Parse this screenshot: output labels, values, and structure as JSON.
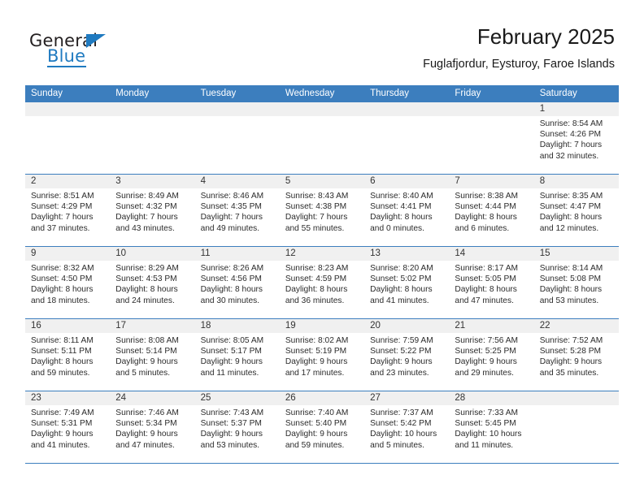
{
  "logo": {
    "primary_text": "General",
    "secondary_text": "Blue",
    "accent_color": "#1f7ac0",
    "triangle_icon": "triangle-icon"
  },
  "header": {
    "title": "February 2025",
    "subtitle": "Fuglafjordur, Eysturoy, Faroe Islands"
  },
  "calendar": {
    "header_bg": "#3c7ebe",
    "weekdays": [
      "Sunday",
      "Monday",
      "Tuesday",
      "Wednesday",
      "Thursday",
      "Friday",
      "Saturday"
    ],
    "weeks": [
      [
        {
          "day": "",
          "lines": []
        },
        {
          "day": "",
          "lines": []
        },
        {
          "day": "",
          "lines": []
        },
        {
          "day": "",
          "lines": []
        },
        {
          "day": "",
          "lines": []
        },
        {
          "day": "",
          "lines": []
        },
        {
          "day": "1",
          "lines": [
            "Sunrise: 8:54 AM",
            "Sunset: 4:26 PM",
            "Daylight: 7 hours",
            "and 32 minutes."
          ]
        }
      ],
      [
        {
          "day": "2",
          "lines": [
            "Sunrise: 8:51 AM",
            "Sunset: 4:29 PM",
            "Daylight: 7 hours",
            "and 37 minutes."
          ]
        },
        {
          "day": "3",
          "lines": [
            "Sunrise: 8:49 AM",
            "Sunset: 4:32 PM",
            "Daylight: 7 hours",
            "and 43 minutes."
          ]
        },
        {
          "day": "4",
          "lines": [
            "Sunrise: 8:46 AM",
            "Sunset: 4:35 PM",
            "Daylight: 7 hours",
            "and 49 minutes."
          ]
        },
        {
          "day": "5",
          "lines": [
            "Sunrise: 8:43 AM",
            "Sunset: 4:38 PM",
            "Daylight: 7 hours",
            "and 55 minutes."
          ]
        },
        {
          "day": "6",
          "lines": [
            "Sunrise: 8:40 AM",
            "Sunset: 4:41 PM",
            "Daylight: 8 hours",
            "and 0 minutes."
          ]
        },
        {
          "day": "7",
          "lines": [
            "Sunrise: 8:38 AM",
            "Sunset: 4:44 PM",
            "Daylight: 8 hours",
            "and 6 minutes."
          ]
        },
        {
          "day": "8",
          "lines": [
            "Sunrise: 8:35 AM",
            "Sunset: 4:47 PM",
            "Daylight: 8 hours",
            "and 12 minutes."
          ]
        }
      ],
      [
        {
          "day": "9",
          "lines": [
            "Sunrise: 8:32 AM",
            "Sunset: 4:50 PM",
            "Daylight: 8 hours",
            "and 18 minutes."
          ]
        },
        {
          "day": "10",
          "lines": [
            "Sunrise: 8:29 AM",
            "Sunset: 4:53 PM",
            "Daylight: 8 hours",
            "and 24 minutes."
          ]
        },
        {
          "day": "11",
          "lines": [
            "Sunrise: 8:26 AM",
            "Sunset: 4:56 PM",
            "Daylight: 8 hours",
            "and 30 minutes."
          ]
        },
        {
          "day": "12",
          "lines": [
            "Sunrise: 8:23 AM",
            "Sunset: 4:59 PM",
            "Daylight: 8 hours",
            "and 36 minutes."
          ]
        },
        {
          "day": "13",
          "lines": [
            "Sunrise: 8:20 AM",
            "Sunset: 5:02 PM",
            "Daylight: 8 hours",
            "and 41 minutes."
          ]
        },
        {
          "day": "14",
          "lines": [
            "Sunrise: 8:17 AM",
            "Sunset: 5:05 PM",
            "Daylight: 8 hours",
            "and 47 minutes."
          ]
        },
        {
          "day": "15",
          "lines": [
            "Sunrise: 8:14 AM",
            "Sunset: 5:08 PM",
            "Daylight: 8 hours",
            "and 53 minutes."
          ]
        }
      ],
      [
        {
          "day": "16",
          "lines": [
            "Sunrise: 8:11 AM",
            "Sunset: 5:11 PM",
            "Daylight: 8 hours",
            "and 59 minutes."
          ]
        },
        {
          "day": "17",
          "lines": [
            "Sunrise: 8:08 AM",
            "Sunset: 5:14 PM",
            "Daylight: 9 hours",
            "and 5 minutes."
          ]
        },
        {
          "day": "18",
          "lines": [
            "Sunrise: 8:05 AM",
            "Sunset: 5:17 PM",
            "Daylight: 9 hours",
            "and 11 minutes."
          ]
        },
        {
          "day": "19",
          "lines": [
            "Sunrise: 8:02 AM",
            "Sunset: 5:19 PM",
            "Daylight: 9 hours",
            "and 17 minutes."
          ]
        },
        {
          "day": "20",
          "lines": [
            "Sunrise: 7:59 AM",
            "Sunset: 5:22 PM",
            "Daylight: 9 hours",
            "and 23 minutes."
          ]
        },
        {
          "day": "21",
          "lines": [
            "Sunrise: 7:56 AM",
            "Sunset: 5:25 PM",
            "Daylight: 9 hours",
            "and 29 minutes."
          ]
        },
        {
          "day": "22",
          "lines": [
            "Sunrise: 7:52 AM",
            "Sunset: 5:28 PM",
            "Daylight: 9 hours",
            "and 35 minutes."
          ]
        }
      ],
      [
        {
          "day": "23",
          "lines": [
            "Sunrise: 7:49 AM",
            "Sunset: 5:31 PM",
            "Daylight: 9 hours",
            "and 41 minutes."
          ]
        },
        {
          "day": "24",
          "lines": [
            "Sunrise: 7:46 AM",
            "Sunset: 5:34 PM",
            "Daylight: 9 hours",
            "and 47 minutes."
          ]
        },
        {
          "day": "25",
          "lines": [
            "Sunrise: 7:43 AM",
            "Sunset: 5:37 PM",
            "Daylight: 9 hours",
            "and 53 minutes."
          ]
        },
        {
          "day": "26",
          "lines": [
            "Sunrise: 7:40 AM",
            "Sunset: 5:40 PM",
            "Daylight: 9 hours",
            "and 59 minutes."
          ]
        },
        {
          "day": "27",
          "lines": [
            "Sunrise: 7:37 AM",
            "Sunset: 5:42 PM",
            "Daylight: 10 hours",
            "and 5 minutes."
          ]
        },
        {
          "day": "28",
          "lines": [
            "Sunrise: 7:33 AM",
            "Sunset: 5:45 PM",
            "Daylight: 10 hours",
            "and 11 minutes."
          ]
        },
        {
          "day": "",
          "lines": []
        }
      ]
    ]
  }
}
